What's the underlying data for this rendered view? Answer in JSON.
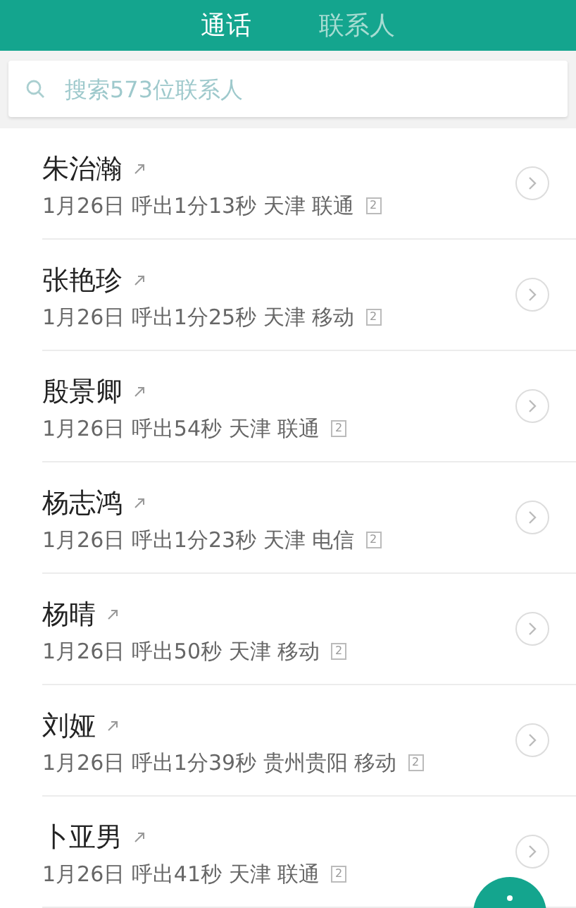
{
  "tabs": [
    {
      "label": "通话",
      "selected": true
    },
    {
      "label": "联系人",
      "selected": false
    }
  ],
  "search": {
    "placeholder": "搜索573位联系人"
  },
  "calls": [
    {
      "name": "朱治瀚",
      "detail": "1月26日 呼出1分13秒 天津 联通",
      "sim": "2"
    },
    {
      "name": "张艳珍",
      "detail": "1月26日 呼出1分25秒 天津 移动",
      "sim": "2"
    },
    {
      "name": "殷景卿",
      "detail": "1月26日 呼出54秒 天津 联通",
      "sim": "2"
    },
    {
      "name": "杨志鸿",
      "detail": "1月26日 呼出1分23秒 天津 电信",
      "sim": "2"
    },
    {
      "name": "杨晴",
      "detail": "1月26日 呼出50秒 天津 移动",
      "sim": "2"
    },
    {
      "name": "刘娅",
      "detail": "1月26日 呼出1分39秒 贵州贵阳 移动",
      "sim": "2"
    },
    {
      "name": "卜亚男",
      "detail": "1月26日 呼出41秒 天津 联通",
      "sim": "2"
    }
  ]
}
